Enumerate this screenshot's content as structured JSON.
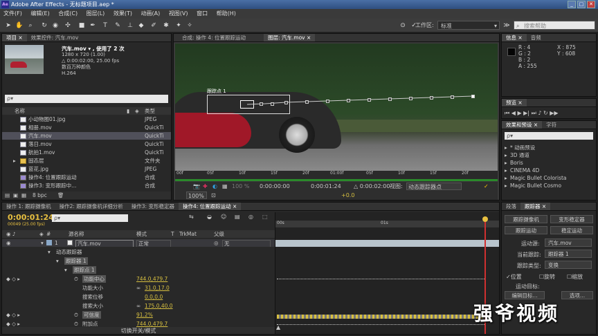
{
  "window": {
    "title": "Adobe After Effects - 无标题项目.aep *",
    "logo": "Ae",
    "minimize": "_",
    "maximize": "□",
    "close": "✕"
  },
  "menu": [
    "文件(F)",
    "编辑(E)",
    "合成(C)",
    "图层(L)",
    "效果(T)",
    "动画(A)",
    "视图(V)",
    "窗口",
    "帮助(H)"
  ],
  "toolbar": {
    "workspace_label": "工作区:",
    "workspace_value": "标准",
    "search_placeholder": "搜索帮助"
  },
  "project": {
    "tabs": [
      "项目 ×",
      "效果控件: 汽车.mov"
    ],
    "item_name": "汽车.mov ▾ , 使用了 2 次",
    "item_info": [
      "1280 x 720 (1.00)",
      "△ 0:00:02:00, 25.00 fps",
      "数百万种颜色",
      "H.264"
    ],
    "search_placeholder": "ρ▾",
    "col_name": "名称",
    "col_type": "类型",
    "items": [
      {
        "name": "小动物图01.jpg",
        "type": "JPEG",
        "kind": "file"
      },
      {
        "name": "相册.mov",
        "type": "QuickTi",
        "kind": "file"
      },
      {
        "name": "汽车.mov",
        "type": "QuickTi",
        "kind": "file"
      },
      {
        "name": "落日.mov",
        "type": "QuickTi",
        "kind": "file"
      },
      {
        "name": "航拍1.mov",
        "type": "QuickTi",
        "kind": "file"
      },
      {
        "name": "固态层",
        "type": "文件夹",
        "kind": "folder"
      },
      {
        "name": "蓝花.jpg",
        "type": "JPEG",
        "kind": "file"
      },
      {
        "name": "操作4: 位置跟踪运动",
        "type": "合成",
        "kind": "comp"
      },
      {
        "name": "操作3: 变形跟踪中...",
        "type": "合成",
        "kind": "comp"
      }
    ],
    "bpc": "8 bpc"
  },
  "viewer": {
    "tabs": [
      "合成: 操作 4: 位置跟踪运动",
      "图层: 汽车.mov ×"
    ],
    "track_point_label": "跟踪点 1",
    "ruler": [
      "00f",
      "05f",
      "10f",
      "15f",
      "20f",
      "01:00f",
      "05f",
      "10f",
      "15f",
      "20f"
    ],
    "zoom": "100%",
    "res": "100 %",
    "time_start": "0:00:00:00",
    "time_current": "0:00:01:24",
    "duration": "△ 0:00:02:00",
    "view_label": "视图:",
    "view_value": "动态跟踪器点",
    "offset": "+0.0"
  },
  "info": {
    "tabs": [
      "信息 ×",
      "音频"
    ],
    "r": "R : 4",
    "g": "G : 2",
    "b": "B : 2",
    "a": "A : 255",
    "x": "X : 875",
    "y": "Y : 608"
  },
  "preview": {
    "tab": "预览 ×"
  },
  "effects": {
    "tabs": [
      "效果和预设 ×",
      "字符"
    ],
    "search_placeholder": "ρ▾",
    "items": [
      "* 动画预设",
      "3D 通道",
      "Boris",
      "CINEMA 4D",
      "Magic Bullet Colorista",
      "Magic Bullet Cosmo"
    ]
  },
  "tracker": {
    "tabs": [
      "段落",
      "跟踪器 ×"
    ],
    "track_camera": "跟踪摄像机",
    "warp_stabilize": "变形稳定器",
    "track_motion": "跟踪运动",
    "stabilize_motion": "稳定运动",
    "motion_source_label": "运动源:",
    "motion_source_value": "汽车.mov",
    "current_track_label": "当前跟踪:",
    "current_track_value": "跟踪器 1",
    "track_type_label": "跟踪类型:",
    "track_type_value": "变换",
    "position": "位置",
    "rotation": "旋转",
    "scale": "缩放",
    "motion_target_label": "运动目标:",
    "edit_target": "编辑目标...",
    "options": "选项..."
  },
  "timeline": {
    "tabs": [
      "操作 1: 跟踪摄像机",
      "操作2: 跟踪摄像机详细分析",
      "操作3: 变形稳定器",
      "操作4: 位置跟踪运动 ×"
    ],
    "timecode": "0:00:01:24",
    "timecode_sub": "00049 (25.00 fps)",
    "col_source": "源名称",
    "col_mode": "模式",
    "col_t": "T",
    "col_trkmat": "TrkMat",
    "col_parent": "父级",
    "layer_num": "1",
    "layer_name": "汽车.mov",
    "layer_mode": "正常",
    "layer_parent": "无",
    "rows": [
      {
        "label": "动态跟踪器",
        "value": ""
      },
      {
        "label": "跟踪器 1",
        "value": ""
      },
      {
        "label": "跟踪点 1",
        "value": ""
      },
      {
        "label": "功能中心",
        "value": "744.0,479.7"
      },
      {
        "label": "功能大小",
        "value": "31.0,17.0"
      },
      {
        "label": "搜索位移",
        "value": "0.0,0.0"
      },
      {
        "label": "搜索大小",
        "value": "175.0,40.0"
      },
      {
        "label": "可信度",
        "value": "91.2%"
      },
      {
        "label": "附加点",
        "value": "744.0,479.7"
      }
    ],
    "ruler": [
      "00s",
      "01s"
    ],
    "toggle_label": "切换开关/模式"
  },
  "watermark": "强爷视频"
}
